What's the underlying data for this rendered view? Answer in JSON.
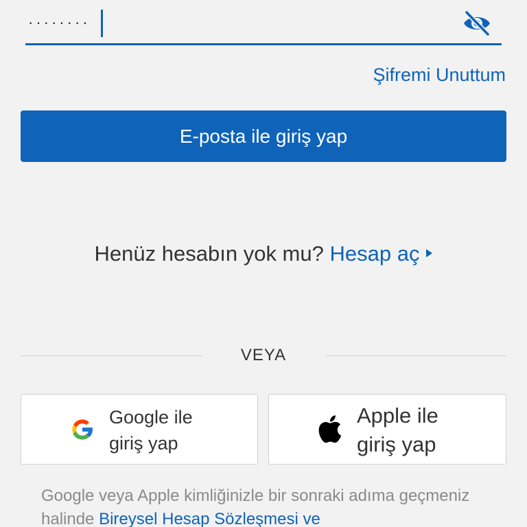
{
  "password_field": {
    "value": "········",
    "visibility_icon": "eye-slash-icon"
  },
  "forgot_password_label": "Şifremi Unuttum",
  "email_login_label": "E-posta ile giriş yap",
  "signup": {
    "prompt": "Henüz hesabın yok mu?",
    "link_label": "Hesap aç",
    "arrow_icon": "arrow-right-icon"
  },
  "divider_label": "VEYA",
  "social": {
    "google": {
      "line1": "Google ile",
      "line2": "giriş yap",
      "icon": "google-icon"
    },
    "apple": {
      "line1": "Apple ile",
      "line2": "giriş yap",
      "icon": "apple-icon"
    }
  },
  "footer": {
    "text": "Google veya Apple kimliğinizle bir sonraki adıma geçmeniz halinde",
    "link_label": "Bireysel Hesap Sözleşmesi ve"
  },
  "colors": {
    "accent": "#0f63b9",
    "background": "#f2f2f2"
  }
}
